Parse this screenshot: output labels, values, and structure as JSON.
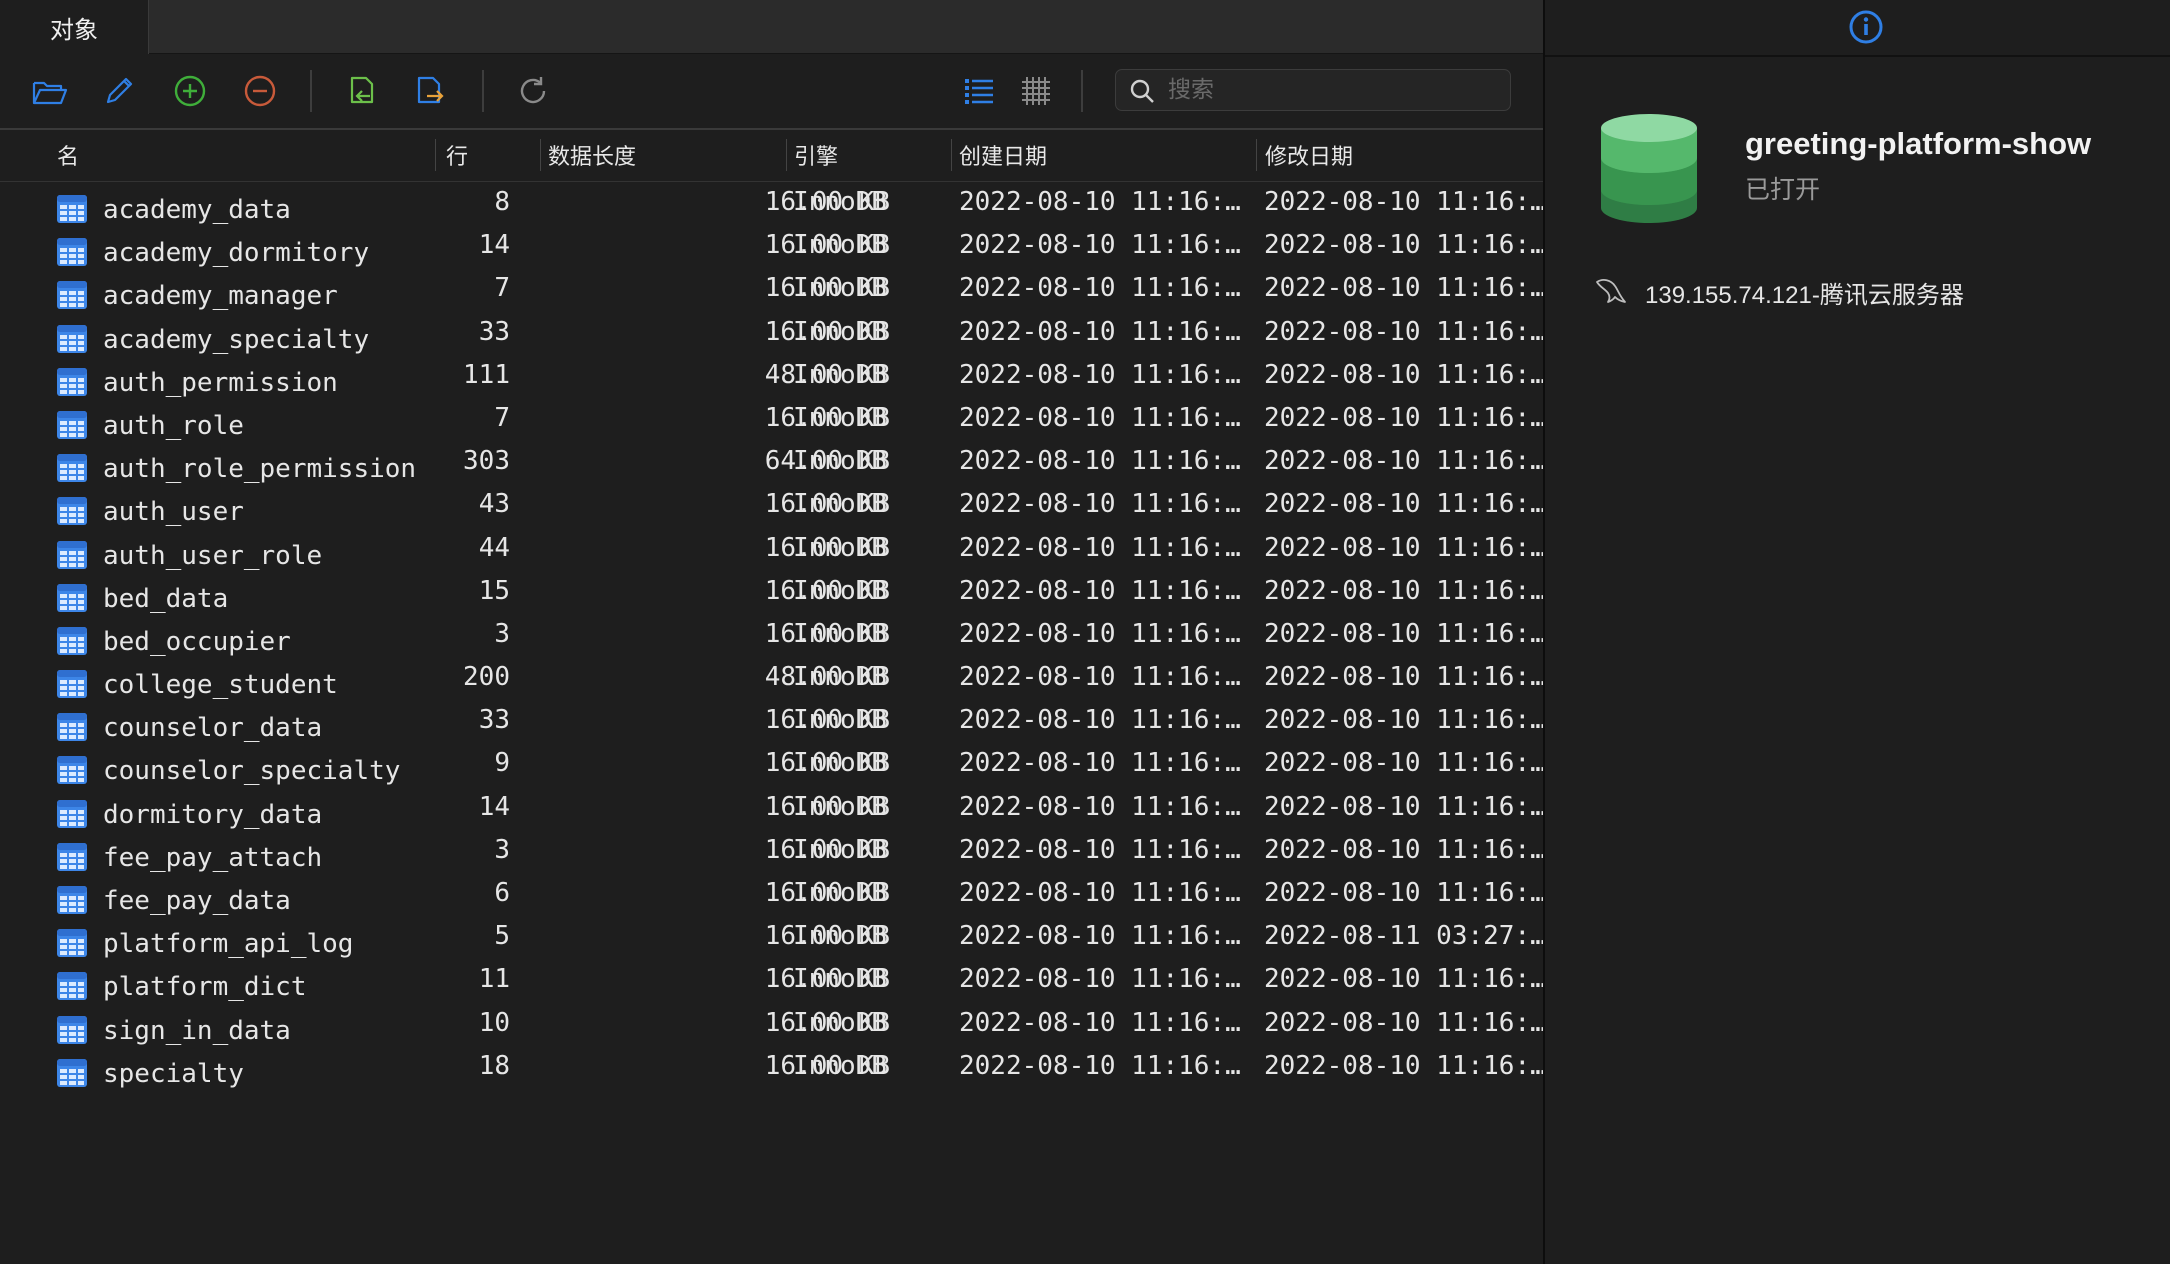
{
  "tab": {
    "label": "对象"
  },
  "search": {
    "placeholder": "搜索",
    "value": ""
  },
  "columns": [
    "名",
    "行",
    "数据长度",
    "引擎",
    "创建日期",
    "修改日期"
  ],
  "colors": {
    "accent": "#2f7fe5",
    "add": "#3fae3a",
    "remove": "#c85a3a",
    "import": "#6cc04a",
    "export": "#e8a23a",
    "db": "#3fa35a"
  },
  "tables": [
    [
      "academy_data",
      "8",
      "16.00 KB",
      "InnoDB",
      "2022-08-10 11:16:…",
      "2022-08-10 11:16:…"
    ],
    [
      "academy_dormitory",
      "14",
      "16.00 KB",
      "InnoDB",
      "2022-08-10 11:16:…",
      "2022-08-10 11:16:…"
    ],
    [
      "academy_manager",
      "7",
      "16.00 KB",
      "InnoDB",
      "2022-08-10 11:16:…",
      "2022-08-10 11:16:…"
    ],
    [
      "academy_specialty",
      "33",
      "16.00 KB",
      "InnoDB",
      "2022-08-10 11:16:…",
      "2022-08-10 11:16:…"
    ],
    [
      "auth_permission",
      "111",
      "48.00 KB",
      "InnoDB",
      "2022-08-10 11:16:…",
      "2022-08-10 11:16:…"
    ],
    [
      "auth_role",
      "7",
      "16.00 KB",
      "InnoDB",
      "2022-08-10 11:16:…",
      "2022-08-10 11:16:…"
    ],
    [
      "auth_role_permission",
      "303",
      "64.00 KB",
      "InnoDB",
      "2022-08-10 11:16:…",
      "2022-08-10 11:16:…"
    ],
    [
      "auth_user",
      "43",
      "16.00 KB",
      "InnoDB",
      "2022-08-10 11:16:…",
      "2022-08-10 11:16:…"
    ],
    [
      "auth_user_role",
      "44",
      "16.00 KB",
      "InnoDB",
      "2022-08-10 11:16:…",
      "2022-08-10 11:16:…"
    ],
    [
      "bed_data",
      "15",
      "16.00 KB",
      "InnoDB",
      "2022-08-10 11:16:…",
      "2022-08-10 11:16:…"
    ],
    [
      "bed_occupier",
      "3",
      "16.00 KB",
      "InnoDB",
      "2022-08-10 11:16:…",
      "2022-08-10 11:16:…"
    ],
    [
      "college_student",
      "200",
      "48.00 KB",
      "InnoDB",
      "2022-08-10 11:16:…",
      "2022-08-10 11:16:…"
    ],
    [
      "counselor_data",
      "33",
      "16.00 KB",
      "InnoDB",
      "2022-08-10 11:16:…",
      "2022-08-10 11:16:…"
    ],
    [
      "counselor_specialty",
      "9",
      "16.00 KB",
      "InnoDB",
      "2022-08-10 11:16:…",
      "2022-08-10 11:16:…"
    ],
    [
      "dormitory_data",
      "14",
      "16.00 KB",
      "InnoDB",
      "2022-08-10 11:16:…",
      "2022-08-10 11:16:…"
    ],
    [
      "fee_pay_attach",
      "3",
      "16.00 KB",
      "InnoDB",
      "2022-08-10 11:16:…",
      "2022-08-10 11:16:…"
    ],
    [
      "fee_pay_data",
      "6",
      "16.00 KB",
      "InnoDB",
      "2022-08-10 11:16:…",
      "2022-08-10 11:16:…"
    ],
    [
      "platform_api_log",
      "5",
      "16.00 KB",
      "InnoDB",
      "2022-08-10 11:16:…",
      "2022-08-11 03:27:…"
    ],
    [
      "platform_dict",
      "11",
      "16.00 KB",
      "InnoDB",
      "2022-08-10 11:16:…",
      "2022-08-10 11:16:…"
    ],
    [
      "sign_in_data",
      "10",
      "16.00 KB",
      "InnoDB",
      "2022-08-10 11:16:…",
      "2022-08-10 11:16:…"
    ],
    [
      "specialty",
      "18",
      "16.00 KB",
      "InnoDB",
      "2022-08-10 11:16:…",
      "2022-08-10 11:16:…"
    ]
  ],
  "sidebar": {
    "db_name": "greeting-platform-show",
    "status": "已打开",
    "connection": "139.155.74.121-腾讯云服务器"
  }
}
